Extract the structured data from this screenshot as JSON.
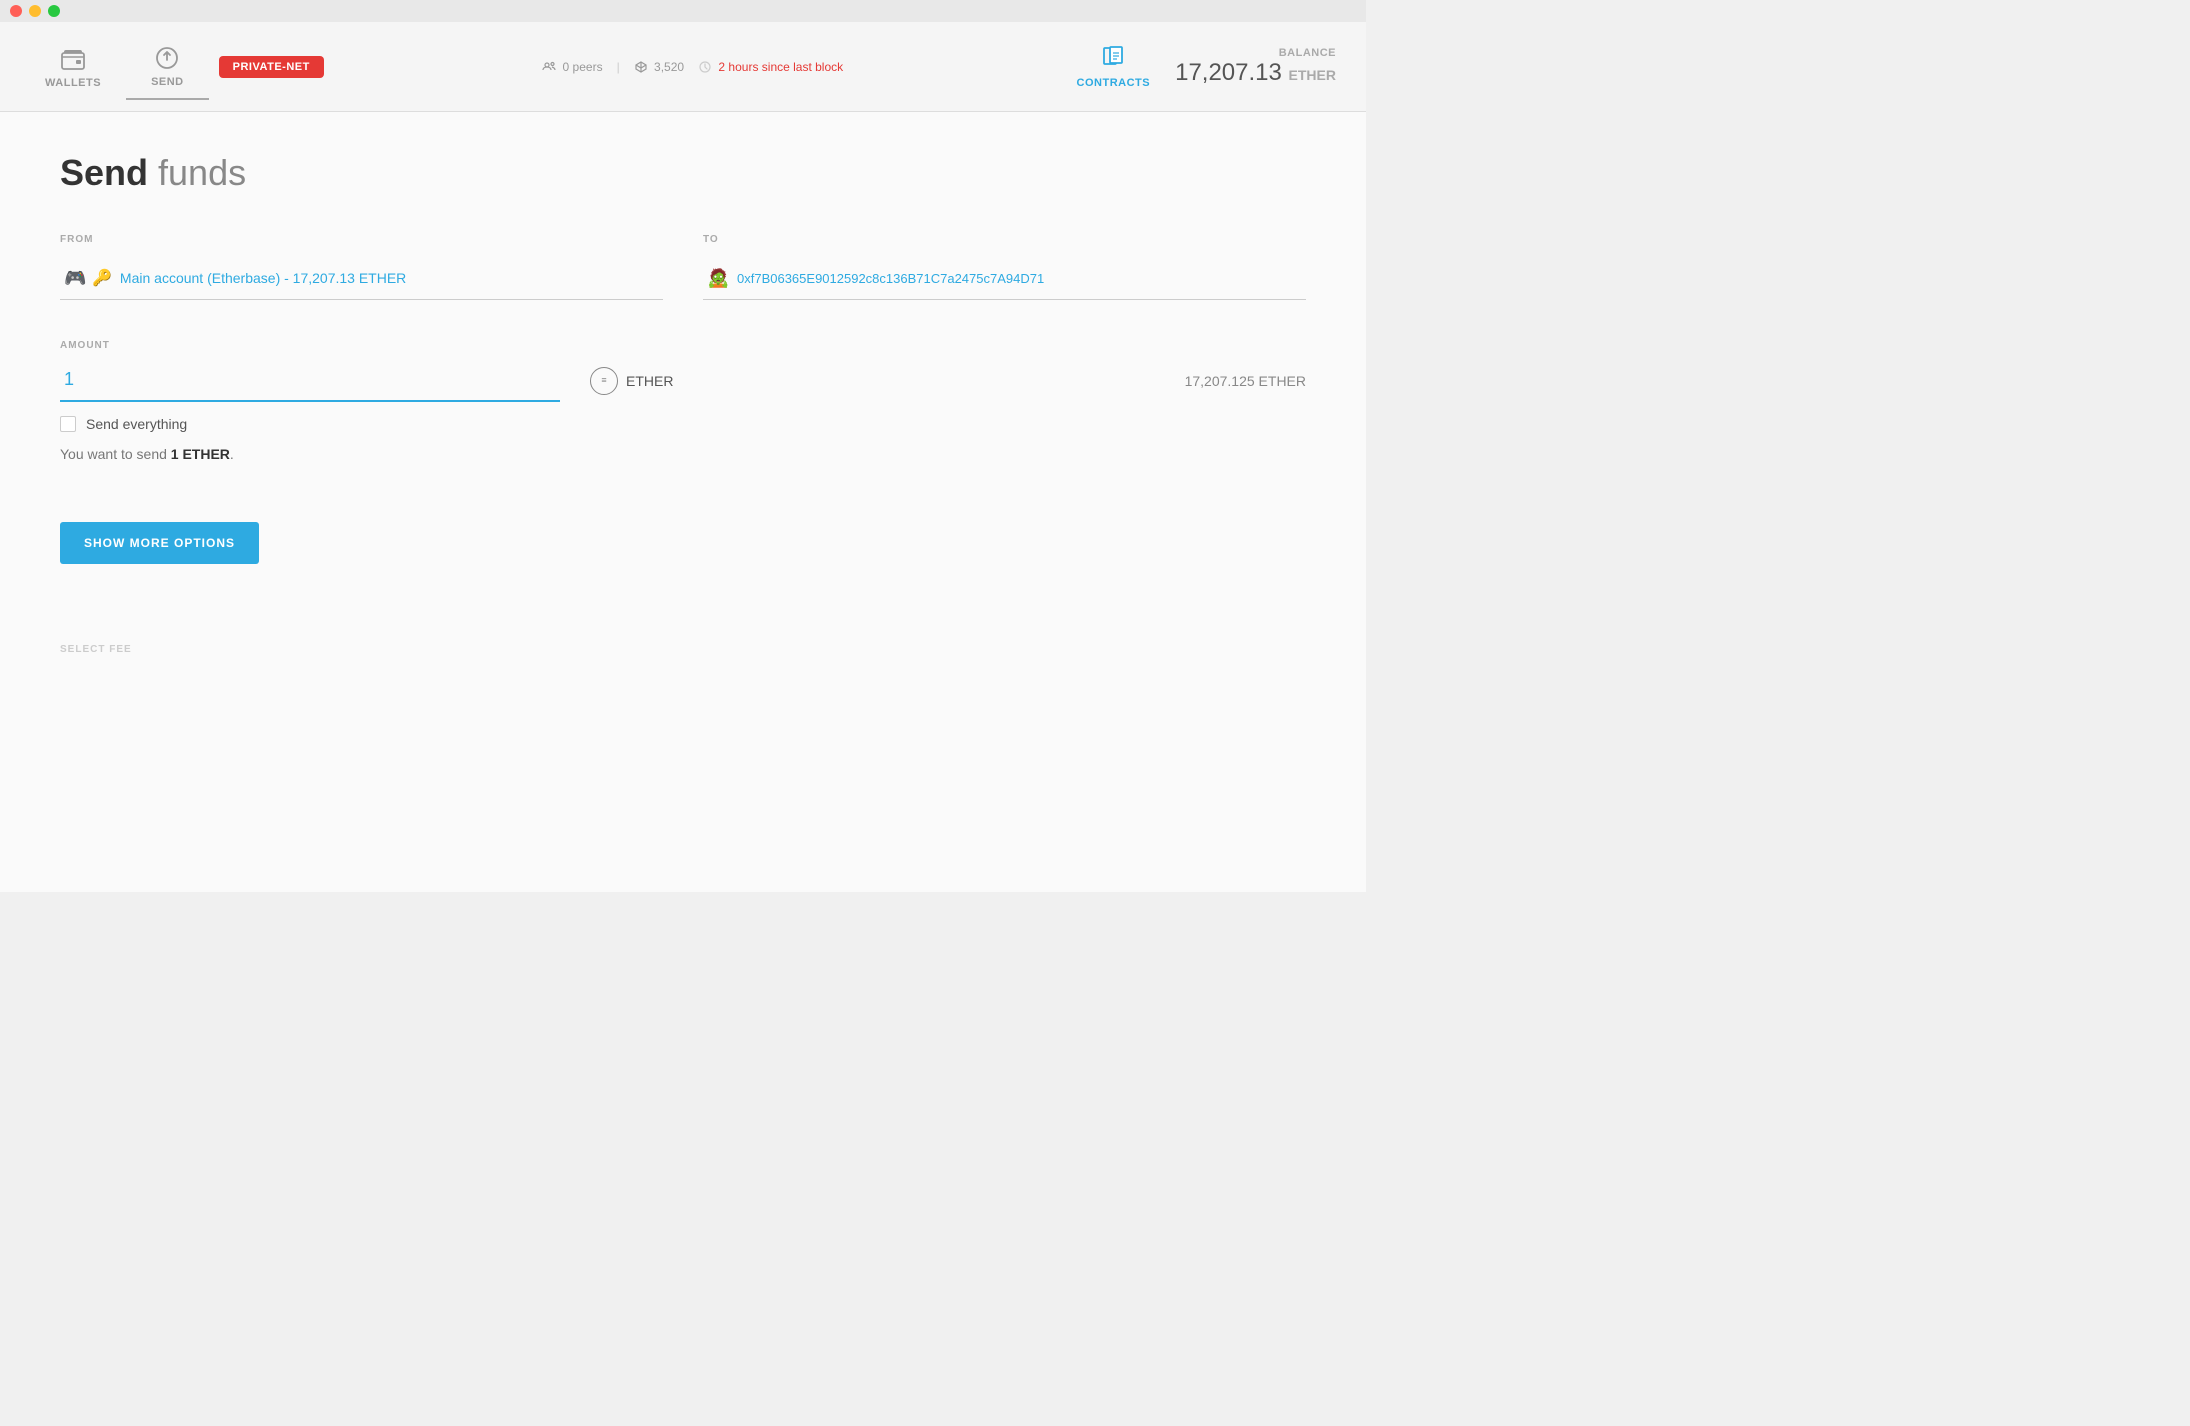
{
  "titlebar": {
    "close_label": "close",
    "minimize_label": "minimize",
    "maximize_label": "maximize"
  },
  "navbar": {
    "wallets_label": "WALLETS",
    "send_label": "SEND",
    "network_badge": "PRIVATE-NET",
    "peers_count": "0 peers",
    "blocks_count": "3,520",
    "last_block": "2 hours since last block",
    "contracts_label": "CONTRACTS",
    "balance_label": "BALANCE",
    "balance_value": "17,207.13",
    "balance_currency": "ETHER"
  },
  "page": {
    "title_bold": "Send",
    "title_light": "funds"
  },
  "form": {
    "from_label": "FROM",
    "from_value": "Main account (Etherbase) - 17,207.13 ETHER",
    "to_label": "TO",
    "to_value": "0xf7B06365E9012592c8c136B71C7a2475c7A94D71",
    "amount_label": "AMOUNT",
    "amount_value": "1",
    "currency_label": "ETHER",
    "available_balance": "17,207.125 ETHER",
    "send_everything_label": "Send everything",
    "summary_text_pre": "You want to send ",
    "summary_bold": "1 ETHER",
    "summary_text_post": ".",
    "show_more_label": "SHOW MORE OPTIONS",
    "select_fee_label": "SELECT FEE"
  }
}
